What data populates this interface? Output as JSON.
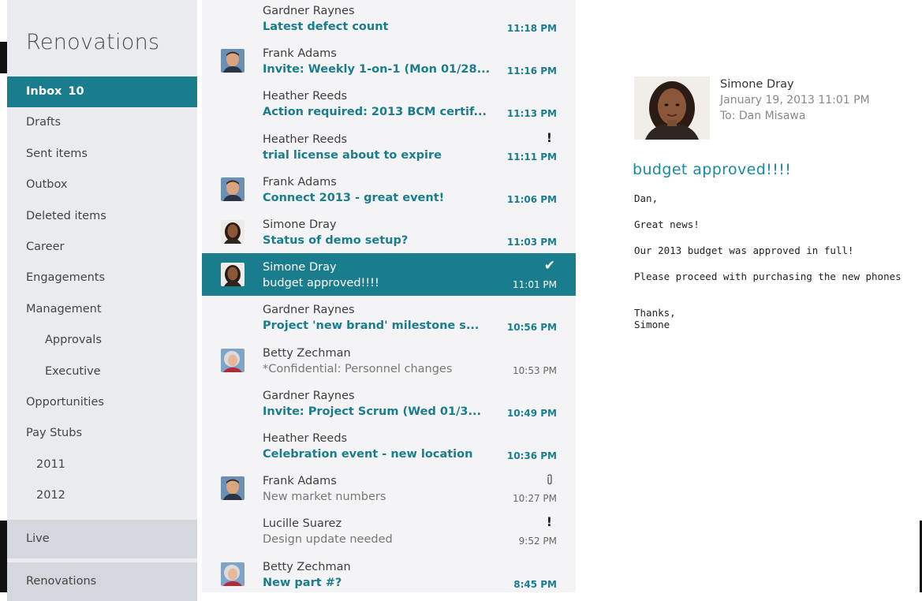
{
  "colors": {
    "accent": "#1a7d8e",
    "folder_bg": "#e9ebef",
    "list_bg": "#f4f4f6"
  },
  "folders": {
    "account_title": "Renovations",
    "items": [
      {
        "label": "Inbox",
        "count": "10",
        "active": true
      },
      {
        "label": "Drafts"
      },
      {
        "label": "Sent items"
      },
      {
        "label": "Outbox"
      },
      {
        "label": "Deleted items"
      },
      {
        "label": "Career"
      },
      {
        "label": "Engagements"
      },
      {
        "label": "Management"
      },
      {
        "label": "Approvals",
        "level": 1
      },
      {
        "label": "Executive",
        "level": 1
      },
      {
        "label": "Opportunities"
      },
      {
        "label": "Pay Stubs"
      },
      {
        "label": "2011",
        "level": 2
      },
      {
        "label": "2012",
        "level": 2
      }
    ],
    "accounts": [
      "Live",
      "Renovations"
    ]
  },
  "messages": [
    {
      "from": "Gardner Raynes",
      "subject": "Latest defect count",
      "time": "11:18 PM",
      "unread": true
    },
    {
      "from": "Frank Adams",
      "subject": "Invite: Weekly 1-on-1 (Mon 01/28...",
      "time": "11:16 PM",
      "unread": true,
      "avatar": "frank"
    },
    {
      "from": "Heather Reeds",
      "subject": "Action required: 2013 BCM certif...",
      "time": "11:13 PM",
      "unread": true
    },
    {
      "from": "Heather Reeds",
      "subject": "trial license about to expire",
      "time": "11:11 PM",
      "unread": true,
      "flag": "!"
    },
    {
      "from": "Frank Adams",
      "subject": "Connect 2013 - great event!",
      "time": "11:06 PM",
      "unread": true,
      "avatar": "frank"
    },
    {
      "from": "Simone Dray",
      "subject": "Status of demo setup?",
      "time": "11:03 PM",
      "unread": true,
      "avatar": "simone"
    },
    {
      "from": "Simone Dray",
      "subject": "budget approved!!!!",
      "time": "11:01 PM",
      "selected": true,
      "avatar": "simone"
    },
    {
      "from": "Gardner Raynes",
      "subject": "Project 'new brand' milestone s...",
      "time": "10:56 PM",
      "unread": true
    },
    {
      "from": "Betty Zechman",
      "subject": "*Confidential: Personnel changes",
      "time": "10:53 PM",
      "avatar": "betty"
    },
    {
      "from": "Gardner Raynes",
      "subject": "Invite: Project Scrum (Wed 01/3...",
      "time": "10:49 PM",
      "unread": true
    },
    {
      "from": "Heather Reeds",
      "subject": "Celebration event - new location",
      "time": "10:36 PM",
      "unread": true
    },
    {
      "from": "Frank Adams",
      "subject": "New market numbers",
      "time": "10:27 PM",
      "avatar": "frank",
      "attachment": true
    },
    {
      "from": "Lucille Suarez",
      "subject": "Design update needed",
      "time": "9:52 PM",
      "flag": "!"
    },
    {
      "from": "Betty Zechman",
      "subject": "New part #?",
      "time": "8:45 PM",
      "unread": true,
      "avatar": "betty"
    }
  ],
  "reader": {
    "from": "Simone Dray",
    "date": "January 19, 2013  11:01 PM",
    "to": "To: Dan Misawa",
    "subject": "budget approved!!!!",
    "body": [
      "Dan,",
      "Great news!",
      "Our 2013 budget was approved in full!",
      "Please proceed with purchasing the new phones"
    ],
    "signoff": "Thanks,",
    "signature": "Simone"
  }
}
